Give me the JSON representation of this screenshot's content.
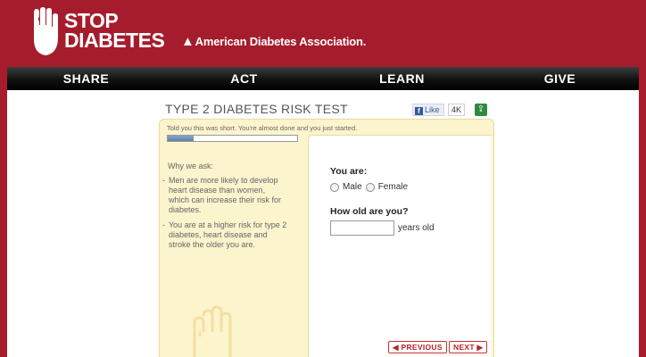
{
  "brand": {
    "logo_line1": "STOP",
    "logo_line2": "DIABETES",
    "org_name": "American Diabetes Association.",
    "colors": {
      "brand_red": "#a51d2d",
      "panel_yellow": "#fbf4cd",
      "progress_blue": "#6d8bb2"
    }
  },
  "nav": [
    "SHARE",
    "ACT",
    "LEARN",
    "GIVE"
  ],
  "test": {
    "title": "TYPE 2 DIABETES RISK TEST",
    "fb_like": "Like",
    "fb_count": "4K",
    "share_icon": "share-icon",
    "message": "Told you this was short. You're almost done and you just started.",
    "progress": 0.2
  },
  "sidebar": {
    "heading": "Why we ask:",
    "reasons": [
      "Men are more likely to develop heart disease than women, which can increase their risk for diabetes.",
      "You are at a higher risk for type 2 diabetes, heart disease and stroke the older you are."
    ]
  },
  "form": {
    "q_gender": "You are:",
    "option_male": "Male",
    "option_female": "Female",
    "q_age": "How old are you?",
    "age_value": "",
    "age_unit": "years old"
  },
  "buttons": {
    "previous": "◀ PREVIOUS",
    "next": "NEXT ▶"
  }
}
